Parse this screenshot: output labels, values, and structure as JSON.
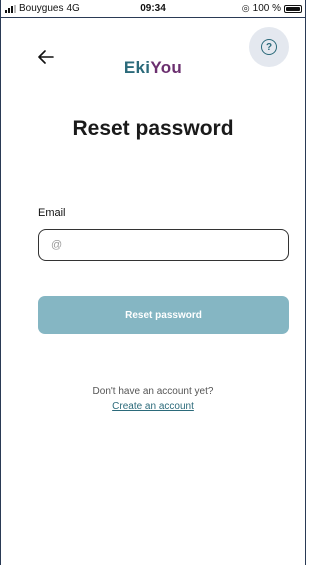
{
  "status_bar": {
    "carrier": "Bouygues",
    "network": "4G",
    "time": "09:34",
    "battery": "100 %"
  },
  "logo": {
    "part1": "Eki",
    "part2": "You"
  },
  "title": "Reset password",
  "form": {
    "email_label": "Email",
    "email_placeholder": "@",
    "email_value": "",
    "submit_label": "Reset password"
  },
  "footer": {
    "no_account_text": "Don't have an account yet?",
    "create_account_link": "Create an account"
  },
  "colors": {
    "primary": "#2b6a7a",
    "accent": "#6b2f6f",
    "button_bg": "#85b6c3",
    "help_bg": "#e4e8ef"
  },
  "icons": [
    "back-arrow-icon",
    "help-question-icon",
    "signal-icon",
    "alarm-icon",
    "battery-icon"
  ]
}
